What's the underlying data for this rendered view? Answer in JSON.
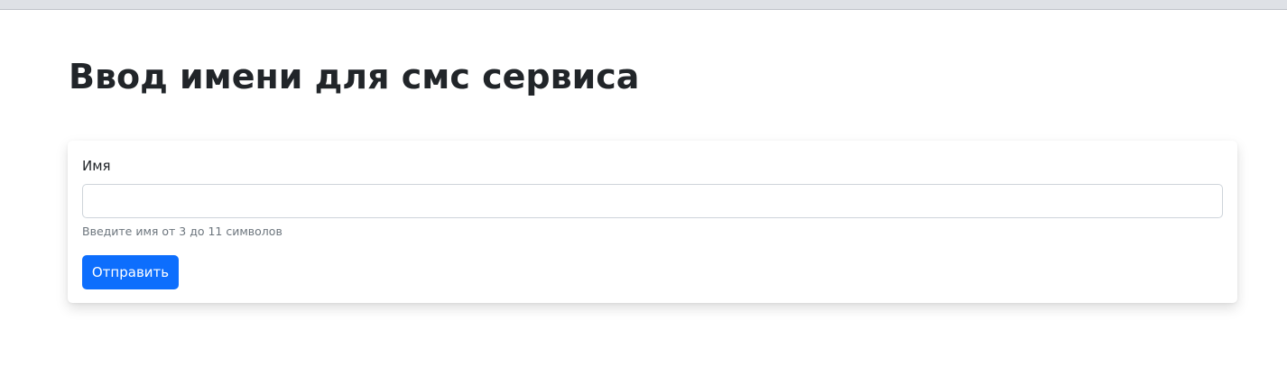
{
  "page": {
    "title": "Ввод имени для смс сервиса"
  },
  "form": {
    "name_label": "Имя",
    "name_value": "",
    "help_text": "Введите имя от 3 до 11 символов",
    "submit_label": "Отправить"
  },
  "colors": {
    "primary": "#0d6efd",
    "muted_text": "#6c757d",
    "heading_text": "#212529",
    "input_border": "#ced4da"
  }
}
